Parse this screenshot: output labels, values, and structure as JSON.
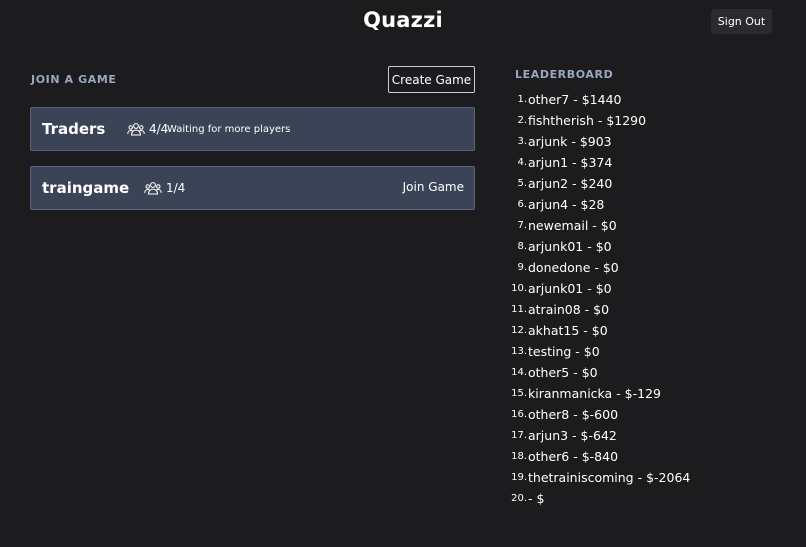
{
  "header": {
    "title": "Quazzi",
    "sign_out_label": "Sign Out"
  },
  "join": {
    "section_title": "JOIN A GAME",
    "create_label": "Create Game",
    "games": [
      {
        "name": "Traders",
        "players": "4/4",
        "status": "Waiting for more players"
      },
      {
        "name": "traingame",
        "players": "1/4",
        "action": "Join Game"
      }
    ]
  },
  "leaderboard": {
    "section_title": "LEADERBOARD",
    "entries": [
      {
        "rank": "1.",
        "text": "other7 - $1440"
      },
      {
        "rank": "2.",
        "text": "fishtherish - $1290"
      },
      {
        "rank": "3.",
        "text": "arjunk - $903"
      },
      {
        "rank": "4.",
        "text": "arjun1 - $374"
      },
      {
        "rank": "5.",
        "text": "arjun2 - $240"
      },
      {
        "rank": "6.",
        "text": "arjun4 - $28"
      },
      {
        "rank": "7.",
        "text": "newemail - $0"
      },
      {
        "rank": "8.",
        "text": "arjunk01 - $0"
      },
      {
        "rank": "9.",
        "text": "donedone - $0"
      },
      {
        "rank": "10.",
        "text": "arjunk01 - $0"
      },
      {
        "rank": "11.",
        "text": "atrain08 - $0"
      },
      {
        "rank": "12.",
        "text": "akhat15 - $0"
      },
      {
        "rank": "13.",
        "text": "testing - $0"
      },
      {
        "rank": "14.",
        "text": "other5 - $0"
      },
      {
        "rank": "15.",
        "text": "kiranmanicka - $-129"
      },
      {
        "rank": "16.",
        "text": "other8 - $-600"
      },
      {
        "rank": "17.",
        "text": "arjun3 - $-642"
      },
      {
        "rank": "18.",
        "text": "other6 - $-840"
      },
      {
        "rank": "19.",
        "text": "thetrainiscoming - $-2064"
      },
      {
        "rank": "20.",
        "text": "- $"
      }
    ]
  },
  "icons": {
    "players": "users-icon"
  },
  "colors": {
    "background": "#1c1c1e",
    "card": "#3b4457",
    "section_title": "#9aa8bd"
  }
}
